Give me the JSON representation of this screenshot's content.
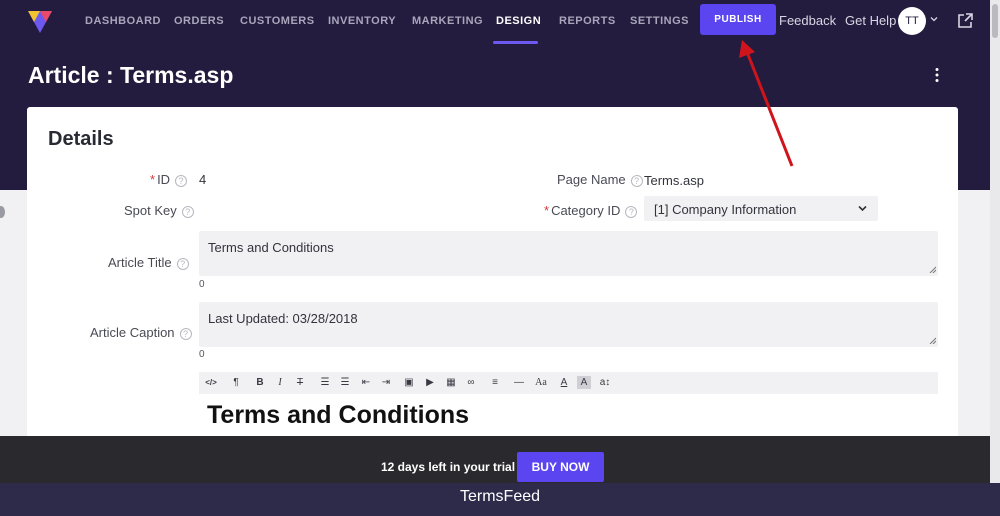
{
  "nav": {
    "items": [
      "DASHBOARD",
      "ORDERS",
      "CUSTOMERS",
      "INVENTORY",
      "MARKETING",
      "DESIGN",
      "REPORTS",
      "SETTINGS"
    ],
    "active": "DESIGN",
    "publish_label": "PUBLISH",
    "feedback_label": "Feedback",
    "help_label": "Get Help",
    "avatar_initials": "TT"
  },
  "page": {
    "title": "Article : Terms.asp"
  },
  "details": {
    "heading": "Details",
    "id_label": "ID",
    "id_value": "4",
    "page_name_label": "Page Name",
    "page_name_value": "Terms.asp",
    "spot_key_label": "Spot Key",
    "category_label": "Category ID",
    "category_value": "[1] Company Information",
    "article_title_label": "Article Title",
    "article_title_value": "Terms and Conditions",
    "article_title_count": "0",
    "article_caption_label": "Article Caption",
    "article_caption_value": "Last Updated: 03/28/2018",
    "article_caption_count": "0",
    "required_mark": "*",
    "help_glyph": "?"
  },
  "editor": {
    "toolbar": [
      {
        "icon": "source-code-icon",
        "glyph": "</>"
      },
      {
        "icon": "paragraph-icon",
        "glyph": "¶"
      },
      {
        "icon": "bold-icon",
        "glyph": "B"
      },
      {
        "icon": "italic-icon",
        "glyph": "I"
      },
      {
        "icon": "strikethrough-icon",
        "glyph": "T"
      },
      {
        "icon": "unordered-list-icon",
        "glyph": "☰"
      },
      {
        "icon": "ordered-list-icon",
        "glyph": "☰"
      },
      {
        "icon": "outdent-icon",
        "glyph": "⇤"
      },
      {
        "icon": "indent-icon",
        "glyph": "⇥"
      },
      {
        "icon": "image-icon",
        "glyph": "▣"
      },
      {
        "icon": "video-icon",
        "glyph": "▶"
      },
      {
        "icon": "table-icon",
        "glyph": "▦"
      },
      {
        "icon": "link-icon",
        "glyph": "∞"
      },
      {
        "icon": "align-icon",
        "glyph": "≡"
      },
      {
        "icon": "horizontal-rule-icon",
        "glyph": "—"
      },
      {
        "icon": "font-size-icon",
        "glyph": "Aa"
      },
      {
        "icon": "font-color-icon",
        "glyph": "A"
      },
      {
        "icon": "background-color-icon",
        "glyph": "A"
      },
      {
        "icon": "text-transform-icon",
        "glyph": "a↕"
      }
    ],
    "heading": "Terms and Conditions"
  },
  "trial": {
    "text": "12 days left in your trial",
    "buy_label": "BUY NOW"
  },
  "footer": {
    "text": "TermsFeed"
  },
  "colors": {
    "accent": "#5b45f0",
    "topbar": "#231c3e",
    "annotation": "#d0141c"
  }
}
